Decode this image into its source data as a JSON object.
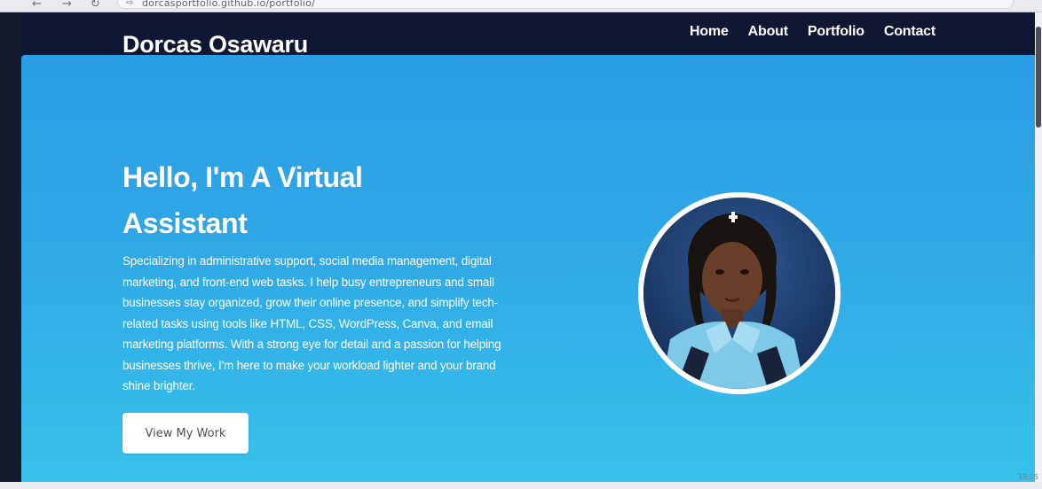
{
  "browser": {
    "url": "dorcasportfolio.github.io/portfolio/"
  },
  "header": {
    "brand": "Dorcas Osawaru",
    "nav": [
      "Home",
      "About",
      "Portfolio",
      "Contact"
    ]
  },
  "hero": {
    "title": "Hello, I'm A Virtual Assistant",
    "text": "Specializing in administrative support, social media management, digital marketing, and front-end web tasks. I help busy entrepreneurs and small businesses stay organized, grow their online presence, and simplify tech-related tasks using tools like HTML, CSS, WordPress, Canva, and email marketing platforms. With a strong eye for detail and a passion for helping businesses thrive, I'm here to make your workload lighter and your brand shine brighter.",
    "button": "View My Work"
  },
  "system": {
    "clock": "19:55"
  },
  "colors": {
    "header_bg": "#101733",
    "hero_top": "#2a9de4",
    "hero_bottom": "#38c2ea",
    "button_bg": "#ffffff"
  },
  "icons": {
    "back": "back-arrow-icon",
    "forward": "forward-arrow-icon",
    "reload": "reload-icon",
    "site_info": "site-info-icon"
  }
}
